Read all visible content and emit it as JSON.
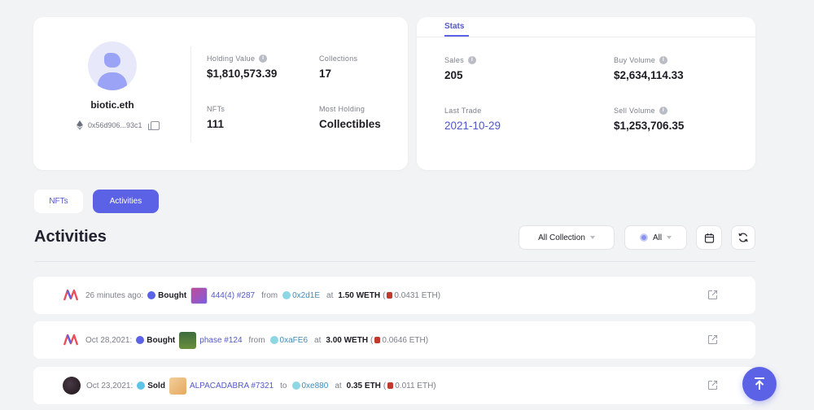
{
  "profile": {
    "ens": "biotic.eth",
    "address_short": "0x56d906...93c1",
    "holding_value_label": "Holding Value",
    "holding_value": "$1,810,573.39",
    "collections_label": "Collections",
    "collections": "17",
    "nfts_label": "NFTs",
    "nfts": "111",
    "most_holding_label": "Most Holding",
    "most_holding": "Collectibles"
  },
  "stats": {
    "tab_label": "Stats",
    "sales_label": "Sales",
    "sales": "205",
    "buy_volume_label": "Buy Volume",
    "buy_volume": "$2,634,114.33",
    "last_trade_label": "Last Trade",
    "last_trade": "2021-10-29",
    "sell_volume_label": "Sell Volume",
    "sell_volume": "$1,253,706.35"
  },
  "tabs": {
    "nfts": "NFTs",
    "activities": "Activities",
    "active": "Activities"
  },
  "activities": {
    "title": "Activities",
    "filter_collection": "All Collection",
    "filter_chain": "All",
    "rows": [
      {
        "time": "26 minutes ago:",
        "type": "Bought",
        "nft": "444(4) #287",
        "dir": "from",
        "wallet": "0x2d1E",
        "at": "at",
        "amount": "1.50 WETH",
        "paren_open": "(",
        "eth": "0.0431 ETH)"
      },
      {
        "time": "Oct 28,2021:",
        "type": "Bought",
        "nft": "phase #124",
        "dir": "from",
        "wallet": "0xaFE6",
        "at": "at",
        "amount": "3.00 WETH",
        "paren_open": "(",
        "eth": "0.0646 ETH)"
      },
      {
        "time": "Oct 23,2021:",
        "type": "Sold",
        "nft": "ALPACADABRA #7321",
        "dir": "to",
        "wallet": "0xe880",
        "at": "at",
        "amount": "0.35 ETH",
        "paren_open": "(",
        "eth": "0.011 ETH)"
      }
    ]
  },
  "colors": {
    "accent": "#5c62e6",
    "link": "#5358c8",
    "background": "#f2f3f5"
  }
}
